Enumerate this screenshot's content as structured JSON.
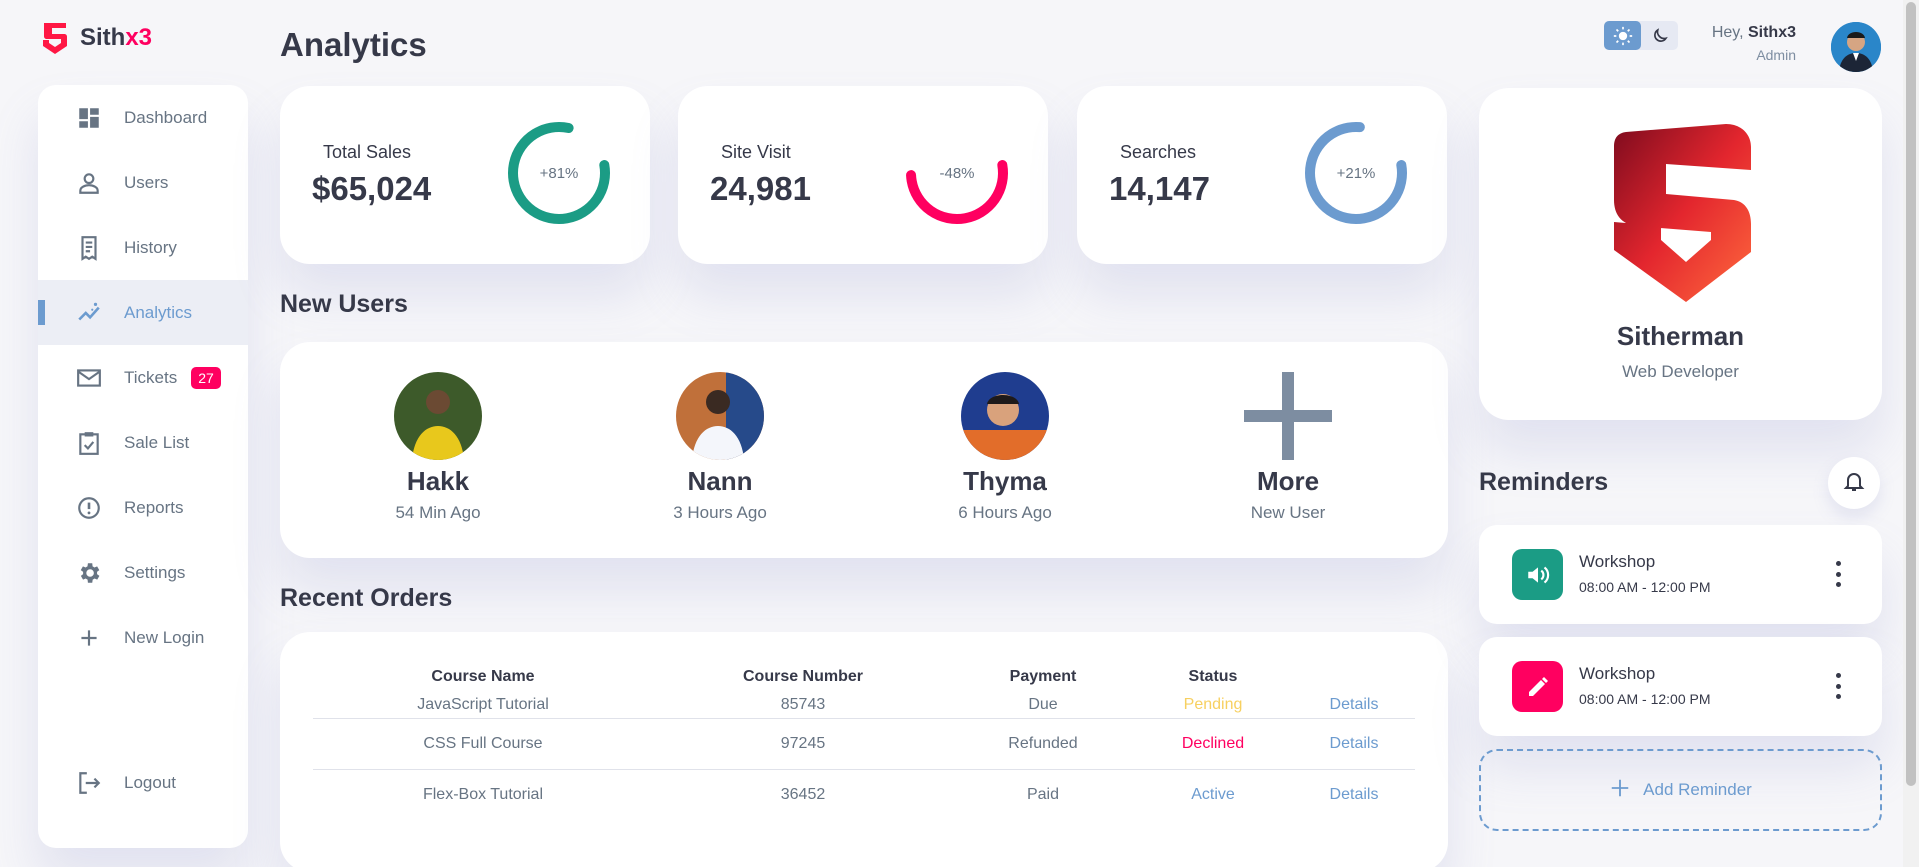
{
  "brand": {
    "name_prefix": "Sith",
    "name_accent": "x3"
  },
  "sidebar": {
    "items": [
      {
        "label": "Dashboard",
        "icon": "dashboard-icon"
      },
      {
        "label": "Users",
        "icon": "person-icon"
      },
      {
        "label": "History",
        "icon": "receipt-icon"
      },
      {
        "label": "Analytics",
        "icon": "insights-icon",
        "active": true
      },
      {
        "label": "Tickets",
        "icon": "mail-icon",
        "badge": "27"
      },
      {
        "label": "Sale List",
        "icon": "clipboard-check-icon"
      },
      {
        "label": "Reports",
        "icon": "report-icon"
      },
      {
        "label": "Settings",
        "icon": "gear-icon"
      },
      {
        "label": "New Login",
        "icon": "plus-icon"
      }
    ],
    "logout": "Logout"
  },
  "page_title": "Analytics",
  "stats": [
    {
      "label": "Total Sales",
      "value": "$65,024",
      "percent": "+81%",
      "fraction": 0.81,
      "color": "#1b9c85"
    },
    {
      "label": "Site Visit",
      "value": "24,981",
      "percent": "-48%",
      "fraction": 0.52,
      "color": "#ff0060"
    },
    {
      "label": "Searches",
      "value": "14,147",
      "percent": "+21%",
      "fraction": 0.79,
      "color": "#6c9bcf"
    }
  ],
  "new_users": {
    "title": "New Users",
    "users": [
      {
        "name": "Hakk",
        "time": "54 Min Ago"
      },
      {
        "name": "Nann",
        "time": "3 Hours Ago"
      },
      {
        "name": "Thyma",
        "time": "6 Hours Ago"
      },
      {
        "name": "More",
        "time": "New User"
      }
    ]
  },
  "recent_orders": {
    "title": "Recent Orders",
    "columns": [
      "Course Name",
      "Course Number",
      "Payment",
      "Status",
      ""
    ],
    "rows": [
      {
        "course": "JavaScript Tutorial",
        "number": "85743",
        "payment": "Due",
        "status": "Pending",
        "status_color": "#f7d060",
        "details": "Details"
      },
      {
        "course": "CSS Full Course",
        "number": "97245",
        "payment": "Refunded",
        "status": "Declined",
        "status_color": "#ff0060",
        "details": "Details"
      },
      {
        "course": "Flex-Box Tutorial",
        "number": "36452",
        "payment": "Paid",
        "status": "Active",
        "status_color": "#6c9bcf",
        "details": "Details"
      }
    ]
  },
  "header": {
    "greeting": "Hey,",
    "username": "Sithx3",
    "role": "Admin"
  },
  "profile": {
    "name": "Sitherman",
    "role": "Web Developer"
  },
  "reminders": {
    "title": "Reminders",
    "items": [
      {
        "title": "Workshop",
        "time": "08:00 AM - 12:00 PM",
        "icon": "volume-icon",
        "color": "#1b9c85"
      },
      {
        "title": "Workshop",
        "time": "08:00 AM - 12:00 PM",
        "icon": "edit-icon",
        "color": "#ff0060"
      }
    ],
    "add_label": "Add Reminder"
  }
}
